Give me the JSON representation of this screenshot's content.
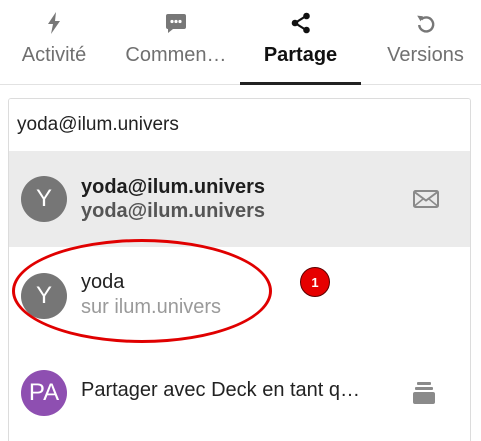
{
  "tabs": [
    {
      "label": "Activité",
      "icon": "lightning-icon",
      "active": false
    },
    {
      "label": "Commen…",
      "icon": "comment-icon",
      "active": false
    },
    {
      "label": "Partage",
      "icon": "share-icon",
      "active": true
    },
    {
      "label": "Versions",
      "icon": "history-icon",
      "active": false
    }
  ],
  "search": {
    "value": "yoda@ilum.univers"
  },
  "results": {
    "email": {
      "avatar": "Y",
      "title": "yoda@ilum.univers",
      "subtitle": "yoda@ilum.univers",
      "icon": "mail-icon"
    },
    "remote": {
      "avatar": "Y",
      "title": "yoda",
      "subtitle": "sur ilum.univers"
    },
    "deck": {
      "avatar": "PA",
      "title": "Partager avec Deck en tant q…",
      "icon": "deck-icon"
    }
  },
  "annotation": {
    "marker": "1",
    "color": "#e00000"
  },
  "colors": {
    "accent": "#222222",
    "avatar_grey": "#767676",
    "avatar_purple": "#8e4fb1",
    "hover": "#ebebeb"
  }
}
